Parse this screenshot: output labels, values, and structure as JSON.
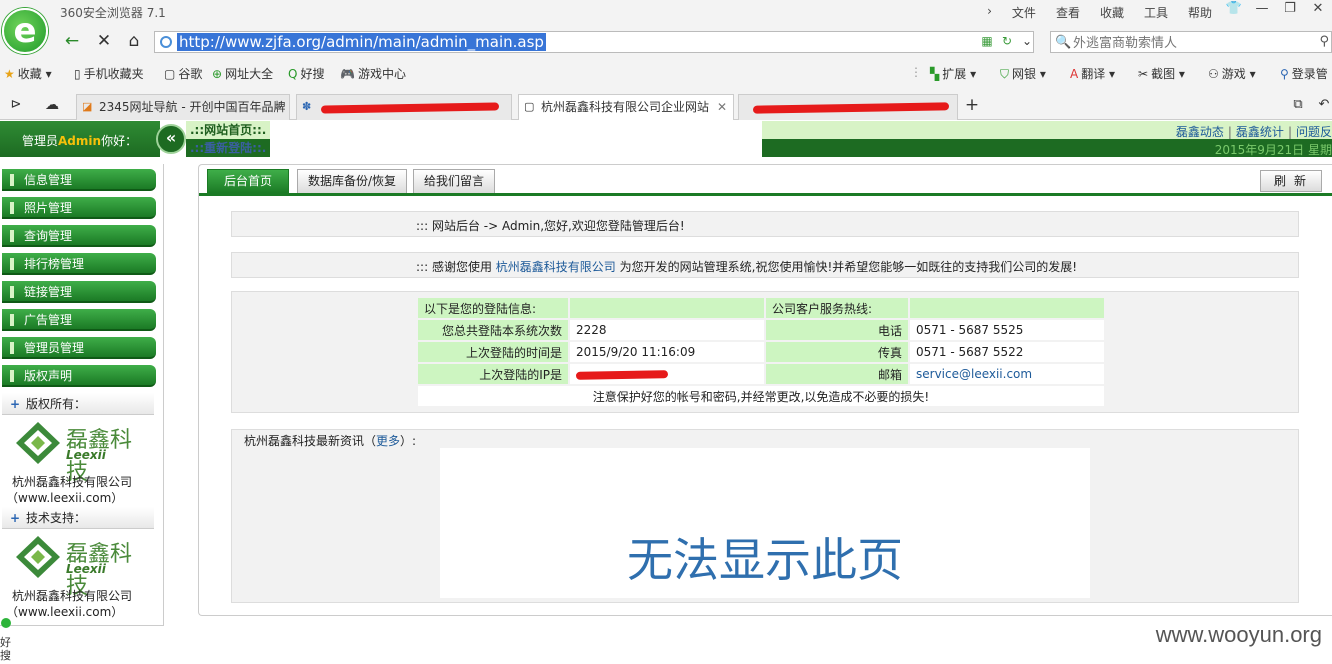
{
  "browser": {
    "app_title": "360安全浏览器 7.1",
    "menu": [
      "文件",
      "查看",
      "收藏",
      "工具",
      "帮助"
    ],
    "url": "http://www.zjfa.org/admin/main/admin_main.asp",
    "search_placeholder": "外逃富商勒索情人",
    "bookmarks": [
      "收藏",
      "手机收藏夹",
      "谷歌",
      "网址大全",
      "好搜",
      "游戏中心"
    ],
    "right_tools": [
      "扩展",
      "网银",
      "翻译",
      "截图",
      "游戏",
      "登录管"
    ],
    "tabs": [
      {
        "label": "2345网址导航 - 开创中国百年品牌",
        "active": false
      },
      {
        "label": "",
        "active": false
      },
      {
        "label": "杭州磊鑫科技有限公司企业网站",
        "active": true
      },
      {
        "label": "",
        "active": false
      }
    ],
    "new_tab": "+"
  },
  "admin_header": {
    "welcome_prefix": "管理员",
    "welcome_user": "Admin",
    "welcome_suffix": "你好：",
    "link_home": ".::网站首页::.",
    "link_relogin": ".::重新登陆::.",
    "right_links": [
      "磊鑫动态",
      "磊鑫统计",
      "问题反"
    ],
    "date": "2015年9月21日 星期"
  },
  "sidebar": {
    "items": [
      "信息管理",
      "照片管理",
      "查询管理",
      "排行榜管理",
      "链接管理",
      "广告管理",
      "管理员管理",
      "版权声明"
    ],
    "copyright_head": "版权所有：",
    "support_head": "技术支持：",
    "brand_cn": "磊鑫科技",
    "brand_en": "Leexii",
    "company": "杭州磊鑫科技有限公司",
    "company_url": "（www.leexii.com）"
  },
  "main": {
    "tabs": [
      "后台首页",
      "数据库备份/恢复",
      "给我们留言"
    ],
    "refresh": "刷新",
    "breadcrumb": "::: 网站后台 -> Admin,您好,欢迎您登陆管理后台!",
    "thanks_prefix": "::: 感谢您使用",
    "thanks_company": "杭州磊鑫科技有限公司",
    "thanks_suffix": "为您开发的网站管理系统,祝您使用愉快!并希望您能够一如既往的支持我们公司的发展!",
    "login_info_head": "以下是您的登陆信息:",
    "hotline_head": "公司客户服务热线:",
    "rows": [
      {
        "label": "您总共登陆本系统次数",
        "value": "2228",
        "label2": "电话",
        "value2": "0571 - 5687 5525"
      },
      {
        "label": "上次登陆的时间是",
        "value": "2015/9/20 11:16:09",
        "label2": "传真",
        "value2": "0571 - 5687 5522"
      },
      {
        "label": "上次登陆的IP是",
        "value": "",
        "label2": "邮箱",
        "value2": "service@leexii.com"
      }
    ],
    "notice": "注意保护好您的帐号和密码,并经常更改,以免造成不必要的损失!",
    "news_prefix": "杭州磊鑫科技最新资讯（",
    "news_more": "更多",
    "news_suffix": "）:",
    "news_error": "无法显示此页"
  },
  "watermark": "www.wooyun.org",
  "corner_text": "好搜",
  "colors": {
    "green": "#1b7a25",
    "light_green": "#cdf5c1",
    "link": "#1d5a99",
    "redaction": "#e61a1a"
  }
}
